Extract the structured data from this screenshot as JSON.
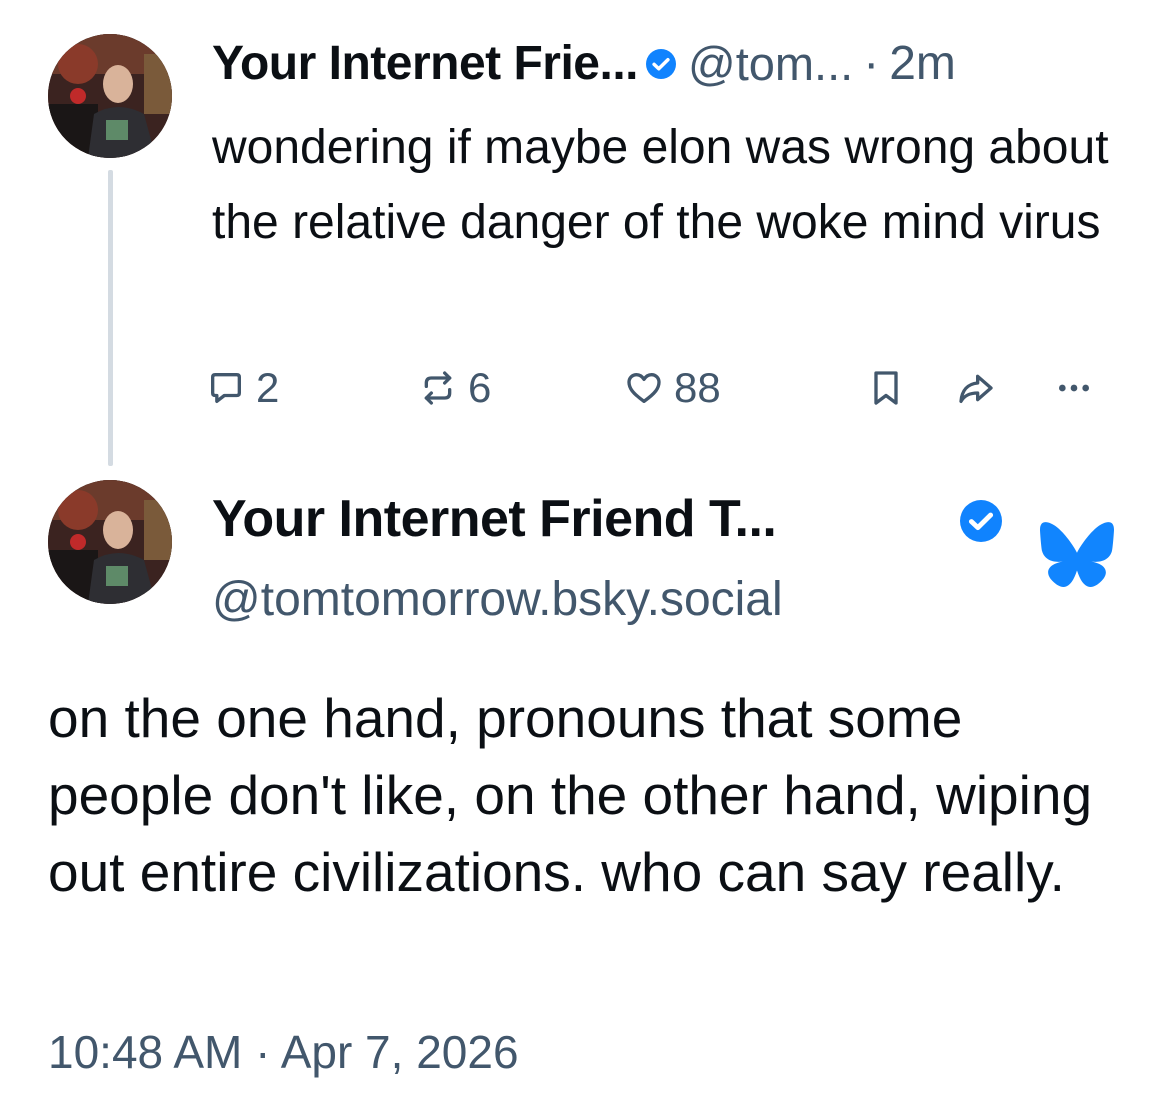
{
  "colors": {
    "text": "#0b0f14",
    "muted": "#42576c",
    "verified": "#1083fe",
    "bluesky": "#1185fe",
    "thread_line": "#d4dbe2"
  },
  "parent_post": {
    "display_name": "Your Internet Frie...",
    "handle": "@tom...",
    "separator": "·",
    "time_ago": "2m",
    "text": "wondering if maybe elon was wrong about the relative danger of the woke mind virus",
    "actions": {
      "reply_count": "2",
      "repost_count": "6",
      "like_count": "88"
    },
    "icons": [
      "avatar",
      "verified-badge-icon",
      "reply-icon",
      "repost-icon",
      "like-icon",
      "bookmark-icon",
      "share-icon",
      "more-icon"
    ]
  },
  "main_post": {
    "display_name": "Your Internet Friend T...",
    "handle": "@tomtomorrow.bsky.social",
    "text": "on the one hand, pronouns that some people don't like, on the other hand, wiping out entire civilizations. who can say really.",
    "timestamp": "10:48 AM · Apr 7, 2026",
    "icons": [
      "avatar",
      "verified-badge-icon",
      "bluesky-butterfly-icon"
    ]
  }
}
